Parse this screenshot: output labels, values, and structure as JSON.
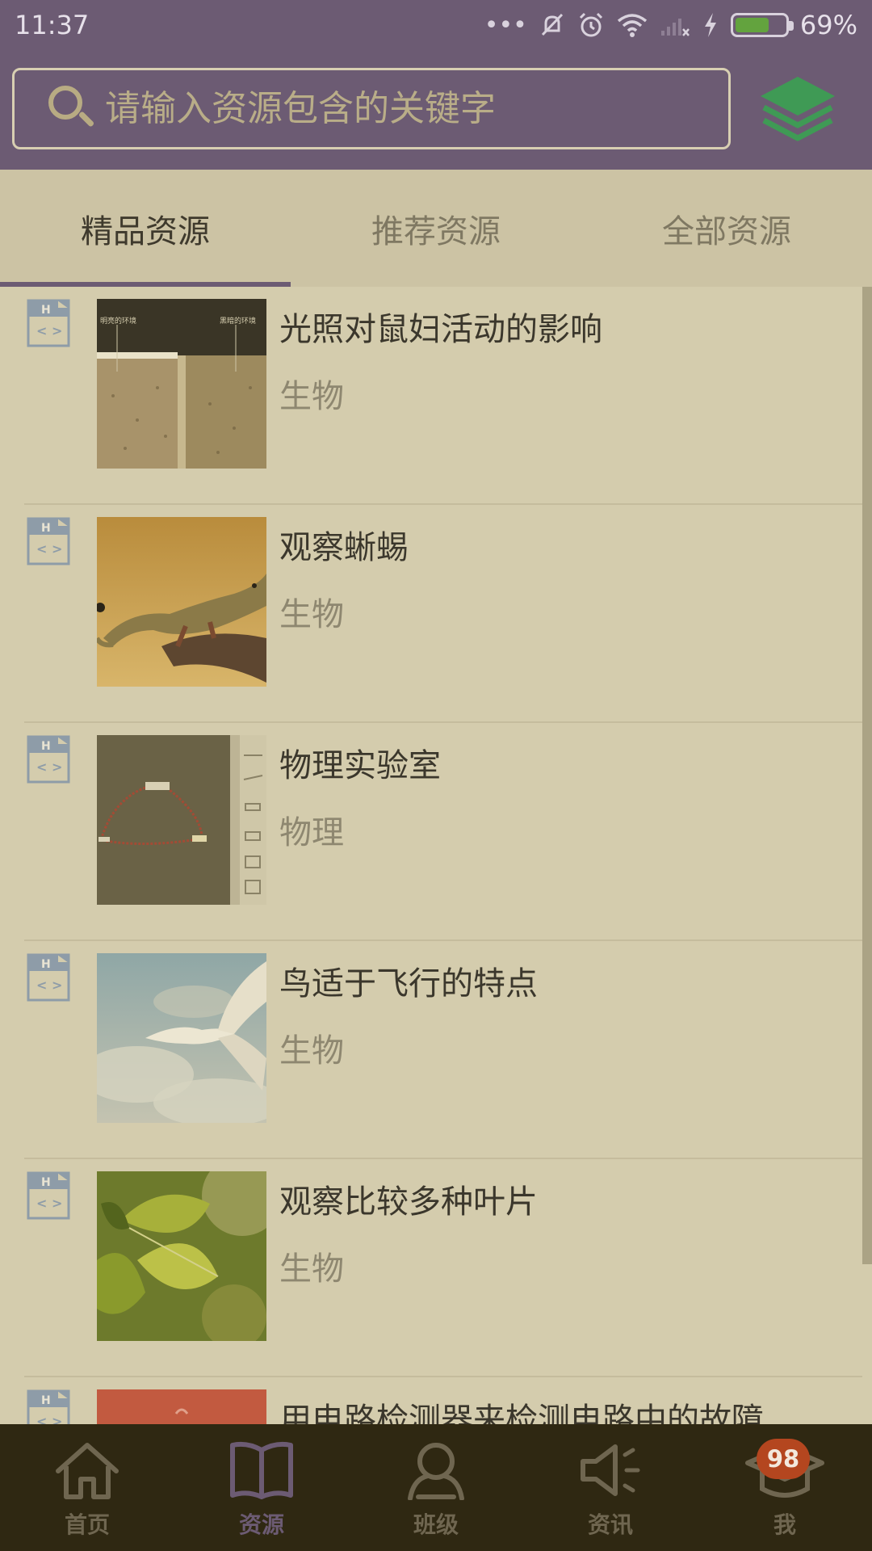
{
  "status_bar": {
    "time": "11:37",
    "dots": "•••",
    "battery_percent": "69%",
    "battery_level": 0.69,
    "icons": [
      "more-dots-icon",
      "mute-icon",
      "alarm-icon",
      "wifi-icon",
      "signal-icon",
      "charging-icon",
      "battery-icon"
    ]
  },
  "search": {
    "placeholder": "请输入资源包含的关键字",
    "value": ""
  },
  "tabs": [
    {
      "label": "精品资源",
      "active": true
    },
    {
      "label": "推荐资源",
      "active": false
    },
    {
      "label": "全部资源",
      "active": false
    }
  ],
  "resources": [
    {
      "title": "光照对鼠妇活动的影响",
      "subject": "生物",
      "thumb_labels": [
        "明亮的环境",
        "黑暗的环境"
      ]
    },
    {
      "title": "观察蜥蜴",
      "subject": "生物"
    },
    {
      "title": "物理实验室",
      "subject": "物理"
    },
    {
      "title": "鸟适于飞行的特点",
      "subject": "生物"
    },
    {
      "title": "观察比较多种叶片",
      "subject": "生物"
    },
    {
      "title": "用电路检测器来检测电路中的故障",
      "subject": ""
    }
  ],
  "bottom_nav": [
    {
      "label": "首页",
      "icon": "home-icon",
      "active": false
    },
    {
      "label": "资源",
      "icon": "book-icon",
      "active": true
    },
    {
      "label": "班级",
      "icon": "people-icon",
      "active": false
    },
    {
      "label": "资讯",
      "icon": "megaphone-icon",
      "active": false
    },
    {
      "label": "我",
      "icon": "graduation-cap-icon",
      "active": false,
      "badge": "98"
    }
  ],
  "colors": {
    "header": "#6c5b73",
    "background": "#d4ccad",
    "nav_background": "#2f2812",
    "badge": "#b4461f",
    "layers_icon": "#3f9a55"
  }
}
